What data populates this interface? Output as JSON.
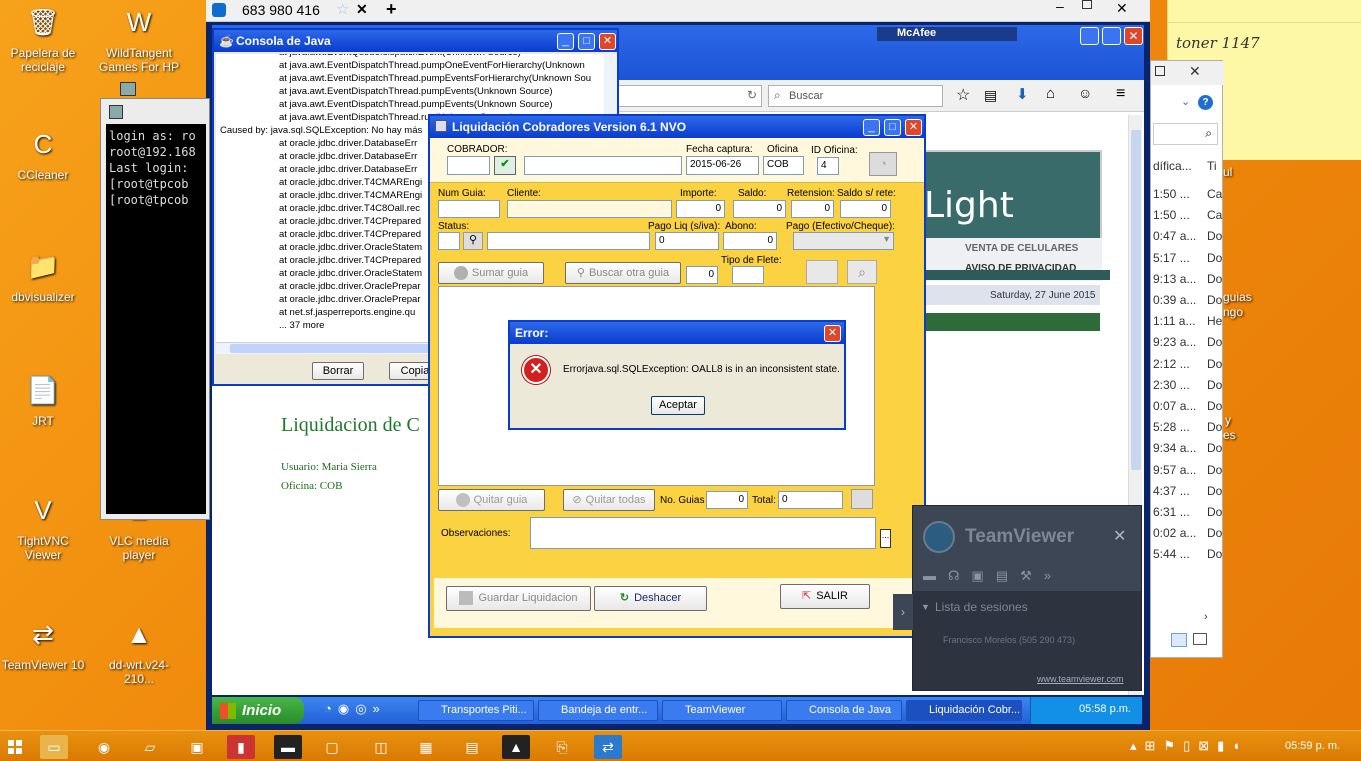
{
  "desktop": {
    "icons": [
      {
        "label": "Papelera de reciclaje",
        "icon": "recycle-bin-icon",
        "glyph": "🗑"
      },
      {
        "label": "WildTangent Games For HP",
        "icon": "wildtangent-icon",
        "glyph": "W"
      },
      {
        "label": "CCleaner",
        "icon": "ccleaner-icon",
        "glyph": "C"
      },
      {
        "label": "dbvisualizer",
        "icon": "folder-icon",
        "glyph": "📁"
      },
      {
        "label": "JRT",
        "icon": "file-icon",
        "glyph": "📄"
      },
      {
        "label": "TightVNC Viewer",
        "icon": "tightvnc-icon",
        "glyph": "V"
      },
      {
        "label": "VLC media player",
        "icon": "vlc-icon",
        "glyph": "▲"
      },
      {
        "label": "TeamViewer 10",
        "icon": "teamviewer-icon",
        "glyph": "⇄"
      },
      {
        "label": "dd-wrt.v24-210...",
        "icon": "vlc-icon",
        "glyph": "▲"
      }
    ]
  },
  "sticky": {
    "text": "toner 1147"
  },
  "teamviewer_tab": {
    "title": "683 980 416"
  },
  "java_console": {
    "title": "Consola de Java",
    "lines": [
      "at java.awt.EventQueue.dispatchEvent(Unknown Source)",
      "at java.awt.EventDispatchThread.pumpOneEventForHierarchy(Unknown",
      "at java.awt.EventDispatchThread.pumpEventsForHierarchy(Unknown Sou",
      "at java.awt.EventDispatchThread.pumpEvents(Unknown Source)",
      "at java.awt.EventDispatchThread.pumpEvents(Unknown Source)",
      "at java.awt.EventDispatchThread.run(Unknown Source)",
      "Caused by: java.sql.SQLException: No hay más",
      "at oracle.jdbc.driver.DatabaseErr",
      "at oracle.jdbc.driver.DatabaseErr",
      "at oracle.jdbc.driver.DatabaseErr",
      "at oracle.jdbc.driver.T4CMAREngi",
      "at oracle.jdbc.driver.T4CMAREngi",
      "at oracle.jdbc.driver.T4C8Oall.rec",
      "at oracle.jdbc.driver.T4CPrepared",
      "at oracle.jdbc.driver.T4CPrepared",
      "at oracle.jdbc.driver.OracleStatem",
      "at oracle.jdbc.driver.T4CPrepared",
      "at oracle.jdbc.driver.OracleStatem",
      "at oracle.jdbc.driver.OraclePrepar",
      "at oracle.jdbc.driver.OraclePrepar",
      "at net.sf.jasperreports.engine.qu",
      "... 37 more"
    ],
    "borrar": "Borrar",
    "copiar": "Copia"
  },
  "putty": {
    "lines": [
      "login as: ro",
      "root@192.168",
      "Last login:",
      "[root@tpcob",
      "[root@tpcob"
    ]
  },
  "firefox": {
    "search": "Buscar",
    "mcafee": "McAfee"
  },
  "web": {
    "brand": "Light",
    "tab1": "VENTA DE CELULARES",
    "tab2": "AVISO DE PRIVACIDAD",
    "date": "Saturday, 27 June 2015",
    "heading": "Liquidacion de C",
    "user": "Usuario: Maria Sierra",
    "office": "Oficina: COB"
  },
  "liq": {
    "title": "Liquidación Cobradores Version 6.1 NVO",
    "cobrador_label": "COBRADOR:",
    "fecha_label": "Fecha captura:",
    "fecha": "2015-06-26",
    "oficina_label": "Oficina",
    "oficina": "COB",
    "idof_label": "ID Oficina:",
    "idof": "4",
    "numguia": "Num Guia:",
    "cliente": "Cliente:",
    "importe": "Importe:",
    "importe_v": "0",
    "saldo": "Saldo:",
    "saldo_v": "0",
    "retencion": "Retension:",
    "retencion_v": "0",
    "saldosr": "Saldo s/ rete:",
    "saldosr_v": "0",
    "status": "Status:",
    "pagoliq": "Pago Liq (s/iva):",
    "pagoliq_v": "0",
    "abono": "Abono:",
    "abono_v": "0",
    "pagotipo": "Pago (Efectivo/Cheque):",
    "sumar": "Sumar guia",
    "buscar": "Buscar otra guia",
    "tipoflete": "Tipo de Flete:",
    "tipoflete_v": "0",
    "quitar": "Quitar guia",
    "quitartodas": "Quitar todas",
    "noguias": "No. Guias",
    "noguias_v": "0",
    "total": "Total:",
    "total_v": "0",
    "obs": "Observaciones:",
    "guardar": "Guardar Liquidacion",
    "deshacer": "Deshacer",
    "salir": "SALIR"
  },
  "error": {
    "title": "Error:",
    "message": "Errorjava.sql.SQLException: OALL8 is in an inconsistent state.",
    "ok": "Aceptar"
  },
  "tv_panel": {
    "brand": "TeamViewer",
    "list_title": "Lista de sesiones",
    "session": "Francisco Morelos (505 290 473)",
    "link": "www.teamviewer.com"
  },
  "explorer_cols": [
    [
      "1:50 ...",
      "Ca"
    ],
    [
      "1:50 ...",
      "Ca"
    ],
    [
      "0:47 a...",
      "Do"
    ],
    [
      "5:17 ...",
      "Do"
    ],
    [
      "9:13 a...",
      "Do"
    ],
    [
      "0:39 a...",
      "Do"
    ],
    [
      "1:11 a...",
      "He"
    ],
    [
      "9:23 a...",
      "Do"
    ],
    [
      "2:12 ...",
      "Do"
    ],
    [
      "2:30 ...",
      "Do"
    ],
    [
      "0:07 a...",
      "Do"
    ],
    [
      "5:28 ...",
      "Do"
    ],
    [
      "9:34 a...",
      "Do"
    ],
    [
      "9:57 a...",
      "Do"
    ],
    [
      "4:37 ...",
      "Do"
    ],
    [
      "6:31 ...",
      "Do"
    ],
    [
      "0:02 a...",
      "Do"
    ],
    [
      "5:44 ...",
      "Do"
    ]
  ],
  "explorer": {
    "col1": "dífica...",
    "col2": "Ti"
  },
  "xp_taskbar": {
    "start": "Inicio",
    "tasks": [
      "Transportes Piti...",
      "Bandeja de entr...",
      "TeamViewer",
      "Consola de Java",
      "Liquidación Cobr..."
    ],
    "clock": "05:58 p.m."
  },
  "win_taskbar": {
    "clock": "05:59 p. m."
  },
  "stray": {
    "guias": "guias",
    "ngo": "ngo",
    "y": "y",
    "es": "es",
    "ul": "ul"
  }
}
